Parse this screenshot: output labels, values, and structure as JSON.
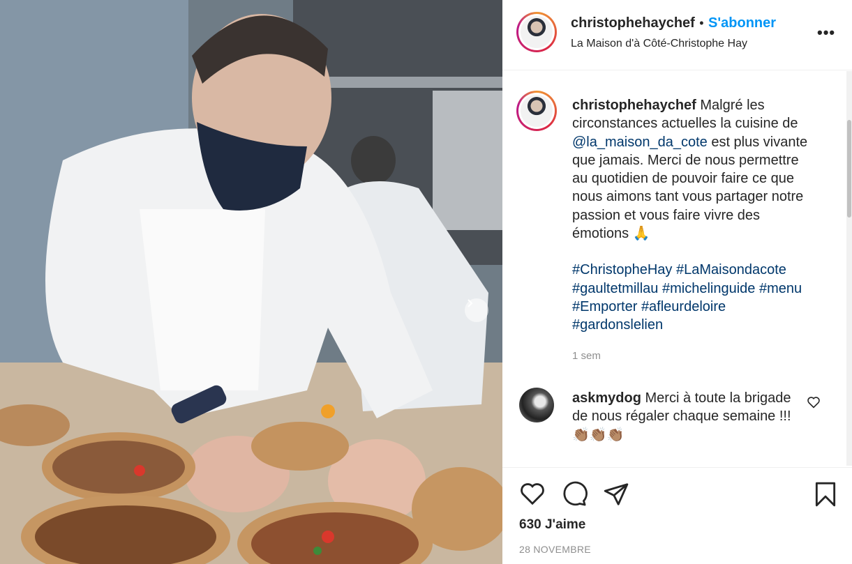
{
  "header": {
    "username": "christophehaychef",
    "separator": "•",
    "follow_label": "S'abonner",
    "location": "La Maison d'à Côté-Christophe Hay",
    "more_icon": "more-options-icon"
  },
  "post": {
    "caption_user": "christophehaychef",
    "caption_text_1": " Malgré les circonstances actuelles la cuisine de ",
    "mention": "@la_maison_da_cote",
    "caption_text_2": " est plus vivante que jamais. Merci de nous permettre au quotidien de pouvoir faire ce que nous aimons tant vous partager notre passion et vous faire vivre des émotions 🙏",
    "hashtags": [
      "#ChristopheHay",
      "#LaMaisondacote",
      "#gaultetmillau",
      "#michelinguide",
      "#menu",
      "#Emporter",
      "#afleurdeloire",
      "#gardonslelien"
    ],
    "time_ago": "1 sem"
  },
  "comments": [
    {
      "user": "askmydog",
      "text": " Merci à toute la brigade de nous régaler chaque semaine !!! 👏🏽👏🏽👏🏽"
    }
  ],
  "footer": {
    "likes": "630 J'aime",
    "date": "28 NOVEMBRE"
  },
  "colors": {
    "link_blue": "#0095f6",
    "hashtag": "#00376b",
    "muted": "#8e8e8e"
  }
}
